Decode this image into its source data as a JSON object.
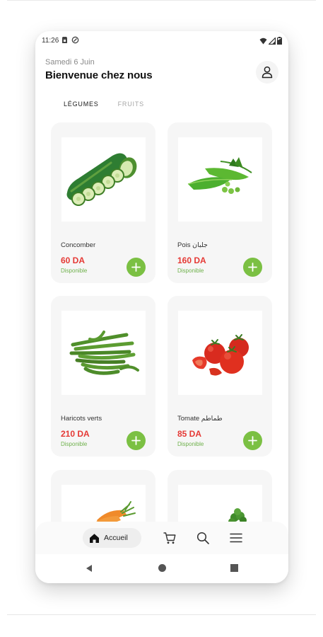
{
  "status_bar": {
    "time": "11:26",
    "left_icons": [
      "sim-card-icon",
      "data-saver-icon"
    ],
    "right_icons": [
      "wifi-icon",
      "signal-icon",
      "battery-icon"
    ]
  },
  "header": {
    "date": "Samedi 6 Juin",
    "welcome": "Bienvenue chez nous",
    "profile_icon": "user-icon"
  },
  "tabs": [
    {
      "label": "LÉGUMES",
      "active": true
    },
    {
      "label": "FRUITS",
      "active": false
    }
  ],
  "products": [
    {
      "name": "Concomber",
      "price": "60 DA",
      "status": "Disponible",
      "image": "cucumber"
    },
    {
      "name": "Pois جلبان",
      "price": "160 DA",
      "status": "Disponible",
      "image": "peas"
    },
    {
      "name": "Haricots verts",
      "price": "210 DA",
      "status": "Disponible",
      "image": "green-beans"
    },
    {
      "name": "Tomate طماطم",
      "price": "85 DA",
      "status": "Disponible",
      "image": "tomatoes"
    },
    {
      "name": "",
      "price": "",
      "status": "",
      "image": "carrots"
    },
    {
      "name": "",
      "price": "",
      "status": "",
      "image": "broccoli"
    }
  ],
  "bottom_nav": {
    "home_label": "Accueil",
    "items": [
      "home-icon",
      "cart-icon",
      "search-icon",
      "menu-icon"
    ]
  },
  "system_nav": [
    "back-icon",
    "home-circle-icon",
    "recents-icon"
  ],
  "colors": {
    "price": "#e53935",
    "available": "#6fb14c",
    "add_button": "#7bc043",
    "card_bg": "#f6f6f6"
  }
}
